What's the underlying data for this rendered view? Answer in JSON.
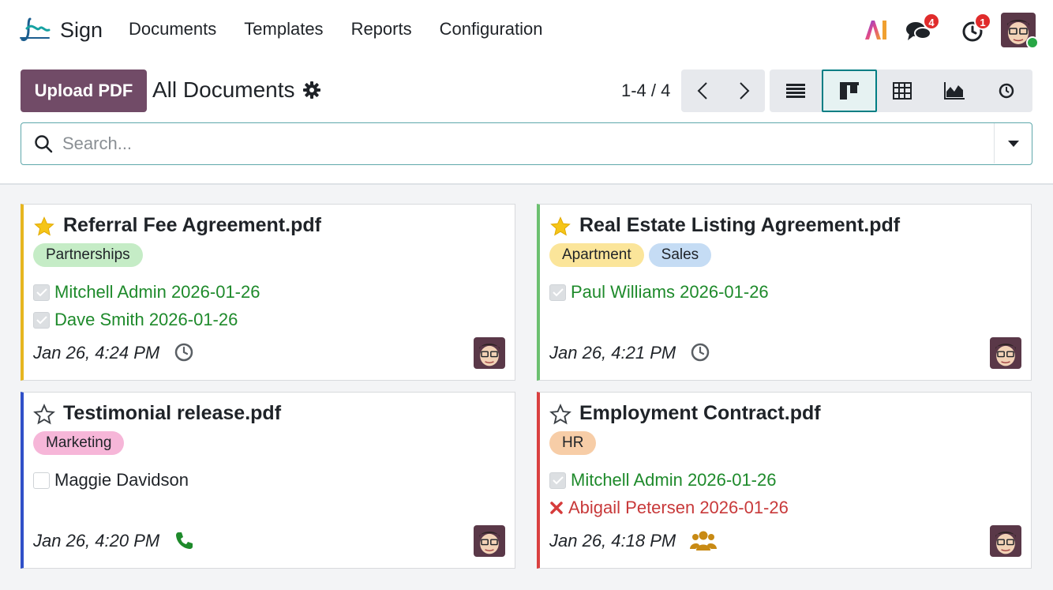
{
  "app": {
    "name": "Sign"
  },
  "nav": {
    "items": [
      "Documents",
      "Templates",
      "Reports",
      "Configuration"
    ]
  },
  "systray": {
    "ai_label": "AI",
    "messages_count": "4",
    "activities_count": "1"
  },
  "control": {
    "upload_label": "Upload PDF",
    "title": "All Documents",
    "pager": "1-4 / 4",
    "views": [
      "list-icon",
      "kanban-icon",
      "pivot-icon",
      "graph-icon",
      "activity-icon"
    ],
    "active_view": "kanban"
  },
  "search": {
    "placeholder": "Search..."
  },
  "colors": {
    "brand": "#714b67",
    "accent": "#017e84",
    "signed": "#1e8a2b",
    "refused": "#c8393a"
  },
  "cards": [
    {
      "title": "Referral Fee Agreement.pdf",
      "starred": true,
      "border_color": "#e6b620",
      "tags": [
        {
          "label": "Partnerships",
          "color": "#c5ecc6"
        }
      ],
      "signers": [
        {
          "text": "Mitchell Admin 2026-01-26",
          "state": "signed"
        },
        {
          "text": "Dave Smith 2026-01-26",
          "state": "signed"
        }
      ],
      "date": "Jan 26, 4:24 PM",
      "activity_icon": "clock-icon"
    },
    {
      "title": "Real Estate Listing Agreement.pdf",
      "starred": true,
      "border_color": "#6cc070",
      "tags": [
        {
          "label": "Apartment",
          "color": "#fbe59a"
        },
        {
          "label": "Sales",
          "color": "#c5dcf4"
        }
      ],
      "signers": [
        {
          "text": "Paul Williams 2026-01-26",
          "state": "signed"
        }
      ],
      "date": "Jan 26, 4:21 PM",
      "activity_icon": "clock-icon"
    },
    {
      "title": "Testimonial release.pdf",
      "starred": false,
      "border_color": "#3050c8",
      "tags": [
        {
          "label": "Marketing",
          "color": "#f6b6d8"
        }
      ],
      "signers": [
        {
          "text": "Maggie Davidson",
          "state": "pending"
        }
      ],
      "date": "Jan 26, 4:20 PM",
      "activity_icon": "phone-icon"
    },
    {
      "title": "Employment Contract.pdf",
      "starred": false,
      "border_color": "#d94040",
      "tags": [
        {
          "label": "HR",
          "color": "#f7cda7"
        }
      ],
      "signers": [
        {
          "text": "Mitchell Admin 2026-01-26",
          "state": "signed"
        },
        {
          "text": "Abigail Petersen 2026-01-26",
          "state": "refused"
        }
      ],
      "date": "Jan 26, 4:18 PM",
      "activity_icon": "users-icon"
    }
  ]
}
